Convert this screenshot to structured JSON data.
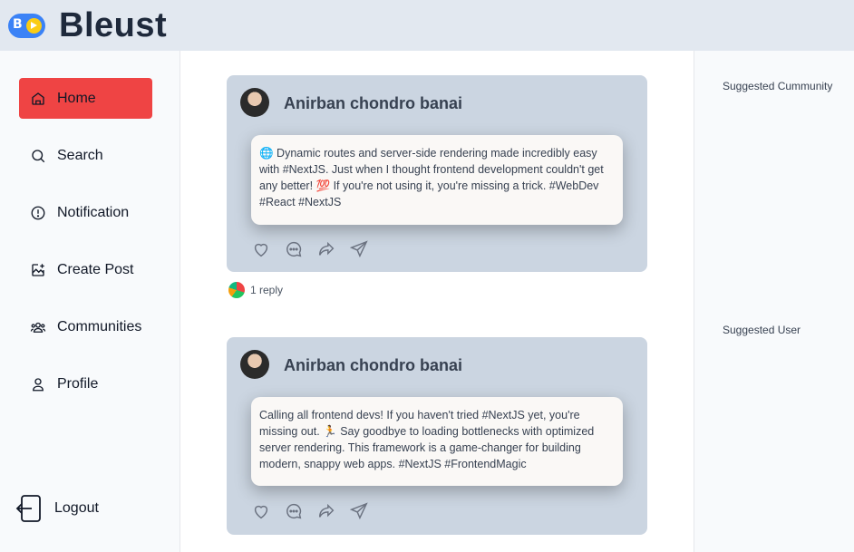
{
  "app": {
    "name": "Bleust",
    "logo_letter": "B"
  },
  "nav": {
    "items": [
      {
        "label": "Home",
        "icon": "home-icon",
        "active": true
      },
      {
        "label": "Search",
        "icon": "search-icon",
        "active": false
      },
      {
        "label": "Notification",
        "icon": "notification-icon",
        "active": false
      },
      {
        "label": "Create Post",
        "icon": "create-post-icon",
        "active": false
      },
      {
        "label": "Communities",
        "icon": "communities-icon",
        "active": false
      },
      {
        "label": "Profile",
        "icon": "profile-icon",
        "active": false
      }
    ],
    "logout_label": "Logout"
  },
  "right_sidebar": {
    "suggested_community": "Suggested Cummunity",
    "suggested_user": "Suggested User"
  },
  "posts": [
    {
      "author": "Anirban chondro banai",
      "text": "🌐 Dynamic routes and server-side rendering made incredibly easy with #NextJS. Just when I thought frontend development couldn't get any better! 💯 If you're not using it, you're missing a trick. #WebDev #React #NextJS",
      "reply_count": "1 reply"
    },
    {
      "author": "Anirban chondro banai",
      "text": "Calling all frontend devs! If you haven't tried #NextJS yet, you're missing out. 🏃 Say goodbye to loading bottlenecks with optimized server rendering. This framework is a game-changer for building modern, snappy web apps. #NextJS #FrontendMagic"
    }
  ],
  "colors": {
    "topbar": "#e2e8f0",
    "active_nav": "#ef4444",
    "card": "#cbd5e1",
    "post_box": "#faf8f6"
  }
}
